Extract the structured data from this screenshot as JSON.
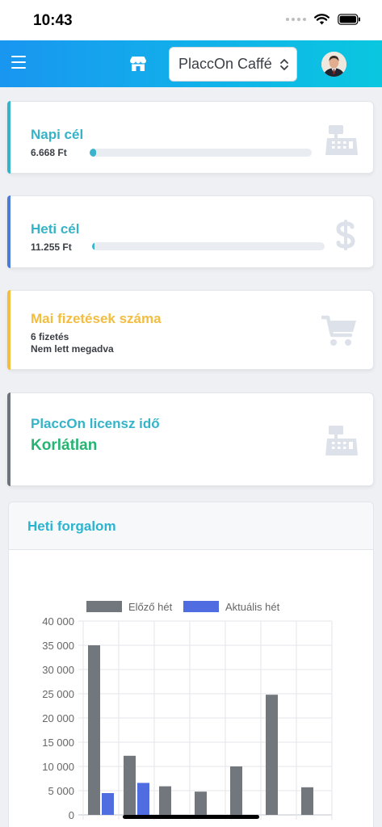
{
  "status_bar": {
    "time": "10:43"
  },
  "header": {
    "store_name": "PlaccOn Caffé"
  },
  "cards": {
    "daily": {
      "title": "Napi cél",
      "amount": "6.668 Ft",
      "progress": 0.03,
      "title_color": "#35b3c9",
      "accent_color": "#35b3c9",
      "icon": "cash-register-icon"
    },
    "weekly": {
      "title": "Heti cél",
      "amount": "11.255 Ft",
      "progress": 0.01,
      "title_color": "#35b3c9",
      "accent_color": "#4a7bd9",
      "icon": "dollar-icon"
    },
    "payments": {
      "title": "Mai fizetések száma",
      "count": "6 fizetés",
      "note": "Nem lett megadva",
      "title_color": "#f2bd41",
      "accent_color": "#f2bd41",
      "icon": "shopping-cart-icon"
    },
    "license": {
      "title": "PlaccOn licensz idő",
      "value": "Korlátlan",
      "title_color": "#35b3c9",
      "value_color": "#27b472",
      "accent_color": "#6c737b",
      "icon": "cash-register-icon"
    }
  },
  "weekly_chart": {
    "title": "Heti forgalom"
  },
  "chart_data": {
    "type": "bar",
    "title": "",
    "xlabel": "",
    "ylabel": "",
    "ylim": [
      0,
      40000
    ],
    "yticks": [
      "40 000",
      "35 000",
      "30 000",
      "25 000",
      "20 000",
      "15 000",
      "10 000",
      "5 000",
      "0"
    ],
    "grid": true,
    "legend_position": "top",
    "series": [
      {
        "name": "Előző hét",
        "color": "#72777d",
        "values": [
          35000,
          12200,
          5900,
          4800,
          10000,
          24800,
          5700
        ]
      },
      {
        "name": "Aktuális hét",
        "color": "#4f6ce0",
        "values": [
          4500,
          6600,
          null,
          null,
          null,
          null,
          null
        ]
      }
    ]
  }
}
